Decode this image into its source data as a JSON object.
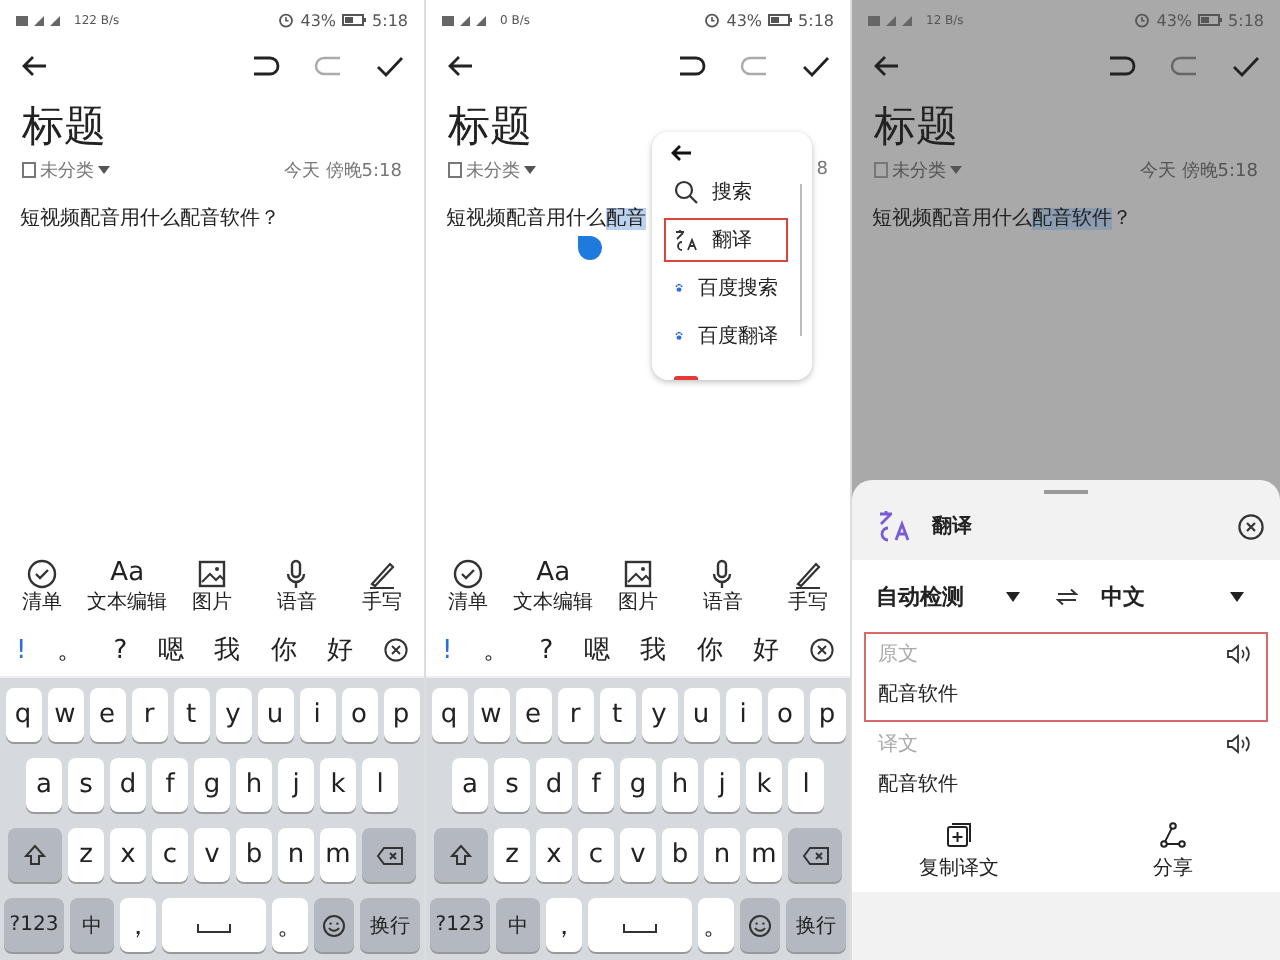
{
  "screens": [
    {
      "kind": "editor",
      "status_bar": {
        "speed": "122 B/s",
        "battery": "43%",
        "time": "5:18"
      },
      "note": {
        "title": "标题",
        "category": "未分类",
        "date": "今天 傍晚5:18",
        "body": [
          {
            "text": "短视频配音用什么配音软件？",
            "selected": false
          }
        ]
      },
      "tools": [
        {
          "kind": "checklist",
          "label": "清单"
        },
        {
          "kind": "text",
          "glyph": "Aa",
          "label": "文本编辑"
        },
        {
          "kind": "image",
          "label": "图片"
        },
        {
          "kind": "voice",
          "label": "语音"
        },
        {
          "kind": "handwrite",
          "label": "手写"
        }
      ],
      "candidates": [
        "!",
        "。",
        "?",
        "嗯",
        "我",
        "你",
        "好"
      ],
      "keyboard": {
        "rows": [
          [
            "q",
            "w",
            "e",
            "r",
            "t",
            "y",
            "u",
            "i",
            "o",
            "p"
          ],
          [
            "a",
            "s",
            "d",
            "f",
            "g",
            "h",
            "j",
            "k",
            "l"
          ],
          [
            "z",
            "x",
            "c",
            "v",
            "b",
            "n",
            "m"
          ]
        ],
        "bottom": [
          {
            "kind": "symbols",
            "label": "?123"
          },
          {
            "kind": "lang",
            "label": "中"
          },
          {
            "kind": "char",
            "label": "，"
          },
          {
            "kind": "space"
          },
          {
            "kind": "char",
            "label": "。"
          },
          {
            "kind": "emoji"
          },
          {
            "kind": "enter",
            "label": "换行"
          }
        ]
      }
    },
    {
      "kind": "menu",
      "status_bar": {
        "speed": "0 B/s",
        "battery": "43%",
        "time": "5:18"
      },
      "note": {
        "title": "标题",
        "category": "未分类",
        "date": "8",
        "body": [
          {
            "text": "短视频配音用什么",
            "selected": false
          },
          {
            "text": "配音",
            "selected": true
          }
        ]
      },
      "popup": {
        "items": [
          {
            "kind": "search",
            "label": "搜索",
            "highlighted": false
          },
          {
            "kind": "translate",
            "label": "翻译",
            "highlighted": true
          },
          {
            "kind": "paw",
            "label": "百度搜索",
            "highlighted": false
          },
          {
            "kind": "paw",
            "label": "百度翻译",
            "highlighted": false
          },
          {
            "kind": "app",
            "highlighted": false
          }
        ]
      },
      "tools": [
        {
          "kind": "checklist",
          "label": "清单"
        },
        {
          "kind": "text",
          "glyph": "Aa",
          "label": "文本编辑"
        },
        {
          "kind": "image",
          "label": "图片"
        },
        {
          "kind": "voice",
          "label": "语音"
        },
        {
          "kind": "handwrite",
          "label": "手写"
        }
      ],
      "candidates": [
        "!",
        "。",
        "?",
        "嗯",
        "我",
        "你",
        "好"
      ],
      "keyboard": {
        "rows": [
          [
            "q",
            "w",
            "e",
            "r",
            "t",
            "y",
            "u",
            "i",
            "o",
            "p"
          ],
          [
            "a",
            "s",
            "d",
            "f",
            "g",
            "h",
            "j",
            "k",
            "l"
          ],
          [
            "z",
            "x",
            "c",
            "v",
            "b",
            "n",
            "m"
          ]
        ],
        "bottom": [
          {
            "kind": "symbols",
            "label": "?123"
          },
          {
            "kind": "lang",
            "label": "中"
          },
          {
            "kind": "char",
            "label": "，"
          },
          {
            "kind": "space"
          },
          {
            "kind": "char",
            "label": "。"
          },
          {
            "kind": "emoji"
          },
          {
            "kind": "enter",
            "label": "换行"
          }
        ]
      }
    },
    {
      "kind": "translate",
      "status_bar": {
        "speed": "12 B/s",
        "battery": "43%",
        "time": "5:18"
      },
      "note": {
        "title": "标题",
        "category": "未分类",
        "date": "今天 傍晚5:18",
        "body": [
          {
            "text": "短视频配音用什么",
            "selected": false
          },
          {
            "text": "配音软件",
            "selected": true
          },
          {
            "text": "？",
            "selected": false
          }
        ]
      },
      "sheet": {
        "title": "翻译",
        "source_language": "自动检测",
        "target_language": "中文",
        "boxes": [
          {
            "label": "原文",
            "text": "配音软件",
            "highlighted": true
          },
          {
            "label": "译文",
            "text": "配音软件",
            "highlighted": false
          }
        ],
        "actions": [
          {
            "kind": "copy",
            "label": "复制译文"
          },
          {
            "kind": "share",
            "label": "分享"
          }
        ]
      }
    }
  ]
}
